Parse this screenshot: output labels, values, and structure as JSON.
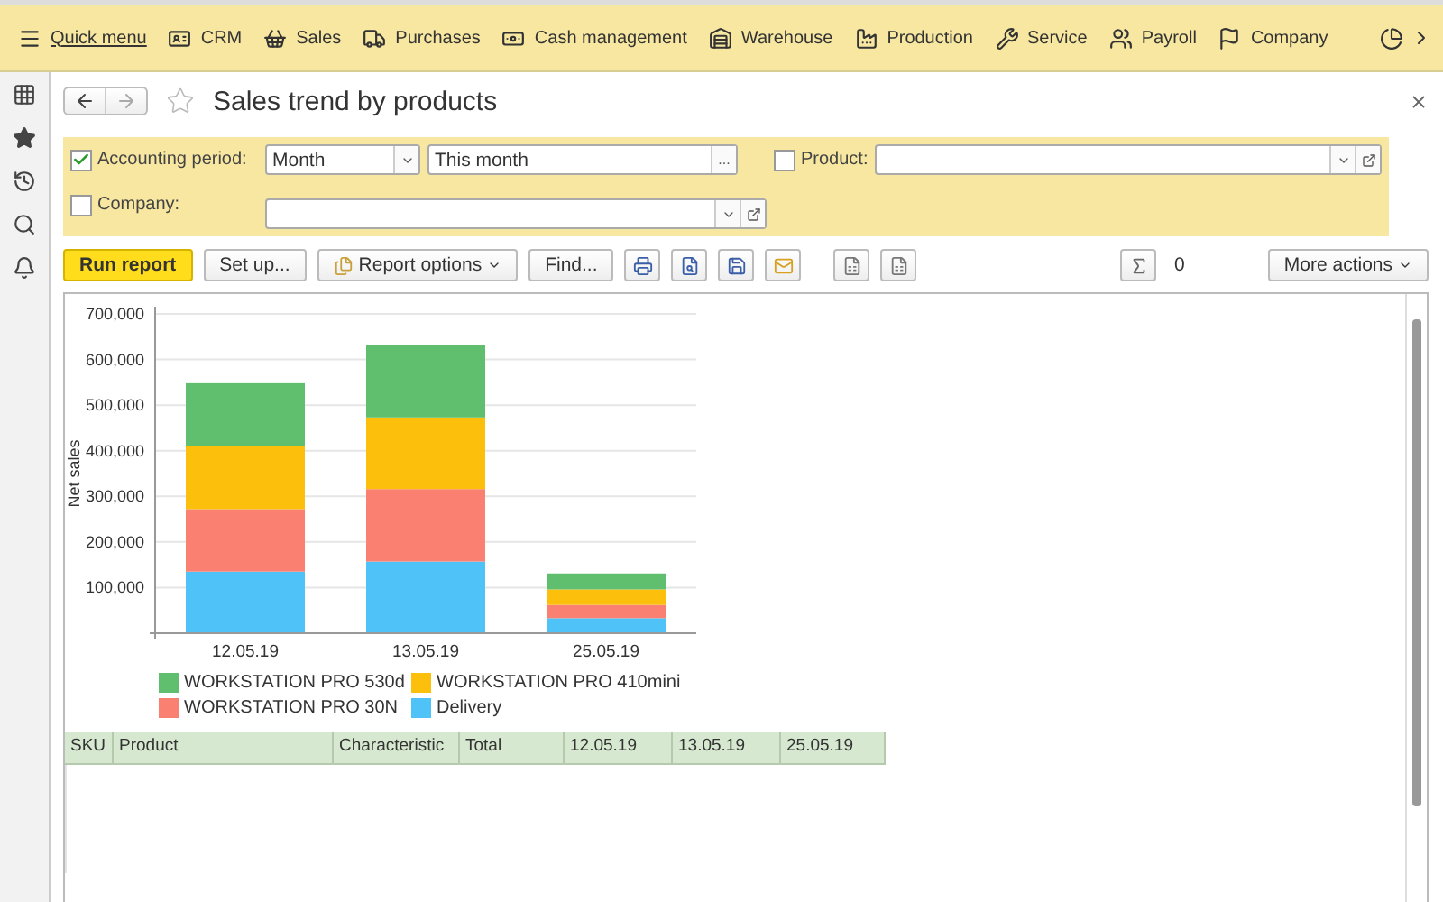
{
  "top_menu": {
    "items": [
      {
        "kind": "menu",
        "label": "Quick menu"
      },
      {
        "kind": "crm",
        "label": "CRM"
      },
      {
        "kind": "sales",
        "label": "Sales"
      },
      {
        "kind": "purchases",
        "label": "Purchases"
      },
      {
        "kind": "cash",
        "label": "Cash management"
      },
      {
        "kind": "warehouse",
        "label": "Warehouse"
      },
      {
        "kind": "production",
        "label": "Production"
      },
      {
        "kind": "service",
        "label": "Service"
      },
      {
        "kind": "payroll",
        "label": "Payroll"
      },
      {
        "kind": "company",
        "label": "Company"
      }
    ]
  },
  "sidebar": {
    "items": [
      {
        "kind": "apps"
      },
      {
        "kind": "favorites"
      },
      {
        "kind": "history"
      },
      {
        "kind": "search"
      },
      {
        "kind": "notifications"
      }
    ]
  },
  "window": {
    "title": "Sales trend by products",
    "favorite": false
  },
  "filters": {
    "accounting_period": {
      "label": "Accounting period:",
      "checked": true,
      "period_type": "Month",
      "period": "This month",
      "choose_button": "..."
    },
    "product": {
      "label": "Product:",
      "checked": false
    },
    "company": {
      "label": "Company:",
      "checked": false
    }
  },
  "toolbar": {
    "run_button": "Run report",
    "setup_button": "Set up...",
    "options_button": "Report options",
    "find_button": "Find...",
    "sum_value": "0",
    "more_button": "More actions"
  },
  "report": {
    "chart_data": {
      "type": "bar",
      "stacked": true,
      "ylabel": "Net sales",
      "categories": [
        "12.05.19",
        "13.05.19",
        "25.05.19"
      ],
      "ylim": [
        0,
        700000
      ],
      "yticks": [
        {
          "value": 100000,
          "label": "100,000"
        },
        {
          "value": 200000,
          "label": "200,000"
        },
        {
          "value": 300000,
          "label": "300,000"
        },
        {
          "value": 400000,
          "label": "400,000"
        },
        {
          "value": 500000,
          "label": "500,000"
        },
        {
          "value": 600000,
          "label": "600,000"
        },
        {
          "value": 700000,
          "label": "700,000"
        }
      ],
      "series": [
        {
          "name": "Delivery",
          "color": "#4fc3f7",
          "values": [
            135000,
            157000,
            33000
          ]
        },
        {
          "name": "WORKSTATION PRO 30N",
          "color": "#fa8072",
          "values": [
            137000,
            159000,
            29000
          ]
        },
        {
          "name": "WORKSTATION PRO 410mini",
          "color": "#fbbf0c",
          "values": [
            138000,
            157000,
            34000
          ]
        },
        {
          "name": "WORKSTATION PRO 530d",
          "color": "#5fbf6e",
          "values": [
            138000,
            159000,
            35000
          ]
        }
      ],
      "grid": true
    },
    "table": {
      "columns": [
        "SKU",
        "Product",
        "Characteristic",
        "Total",
        "12.05.19",
        "13.05.19",
        "25.05.19"
      ]
    }
  }
}
